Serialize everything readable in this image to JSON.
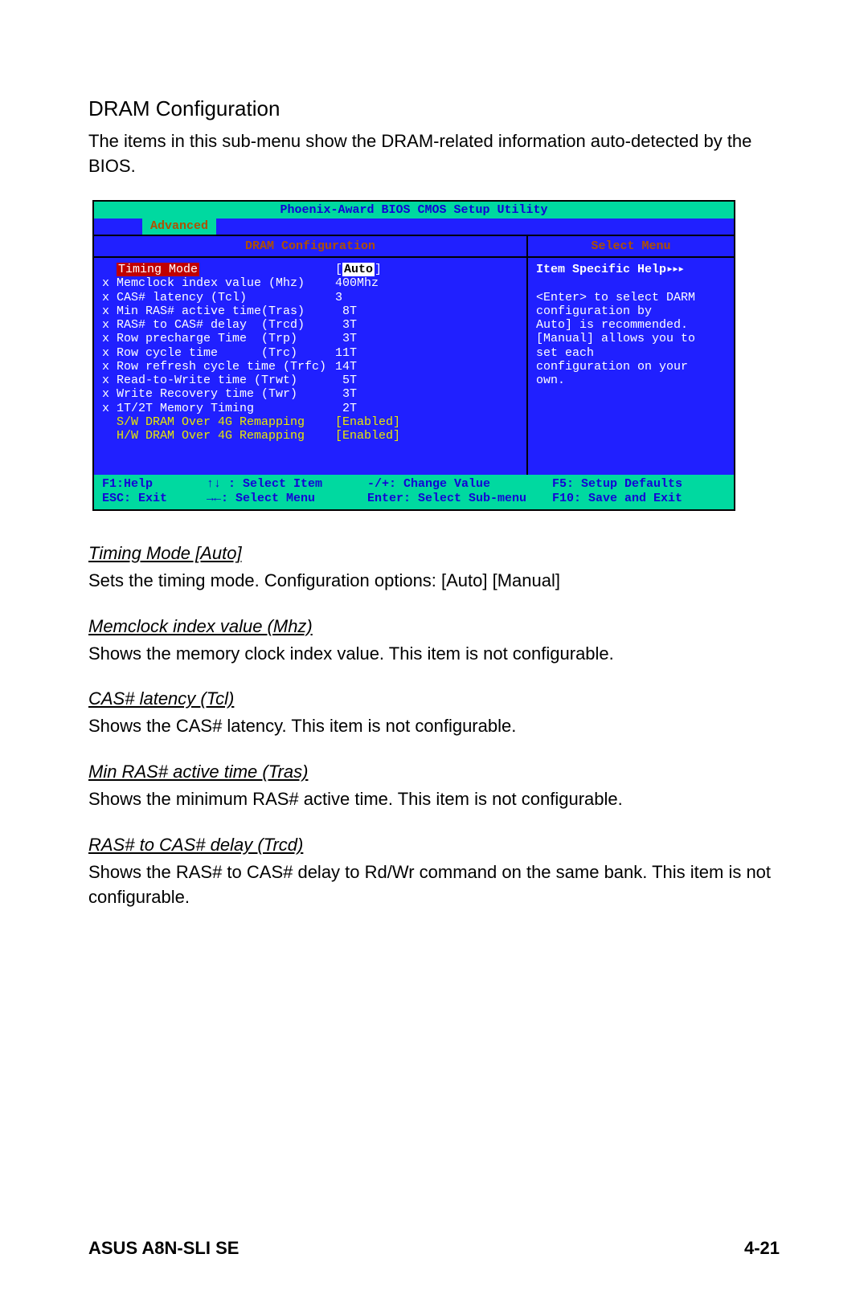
{
  "heading": "DRAM Configuration",
  "intro": "The items in this sub-menu show the DRAM-related information auto-detected by the BIOS.",
  "bios": {
    "title": "Phoenix-Award BIOS CMOS Setup Utility",
    "menuTab": "Advanced",
    "leftHeader": "DRAM Configuration",
    "rightHeader": "Select Menu",
    "rows": [
      {
        "label": "  Timing Mode",
        "value": "Auto",
        "selected": true
      },
      {
        "label": "x Memclock index value (Mhz)",
        "value": "400Mhz"
      },
      {
        "label": "x CAS# latency (Tcl)",
        "value": "3"
      },
      {
        "label": "x Min RAS# active time(Tras)",
        "value": " 8T"
      },
      {
        "label": "x RAS# to CAS# delay  (Trcd)",
        "value": " 3T"
      },
      {
        "label": "x Row precharge Time  (Trp)",
        "value": " 3T"
      },
      {
        "label": "x Row cycle time      (Trc)",
        "value": "11T"
      },
      {
        "label": "x Row refresh cycle time (Trfc)",
        "value": "14T"
      },
      {
        "label": "x Read-to-Write time (Trwt)",
        "value": " 5T"
      },
      {
        "label": "x Write Recovery time (Twr)",
        "value": " 3T"
      },
      {
        "label": "x 1T/2T Memory Timing",
        "value": " 2T"
      },
      {
        "label": "  S/W DRAM Over 4G Remapping",
        "value": "[Enabled]",
        "yellow": true
      },
      {
        "label": "  H/W DRAM Over 4G Remapping",
        "value": "[Enabled]",
        "yellow": true
      }
    ],
    "help": {
      "title": "Item Specific Help",
      "arrows": "▸▸▸",
      "lines": [
        "",
        "<Enter> to select DARM",
        "configuration by",
        "Auto] is recommended.",
        "[Manual] allows you to",
        "set each",
        "configuration on your",
        "own."
      ]
    },
    "footer": {
      "c1a": "F1:Help",
      "c2a": "↑↓ : Select Item",
      "c3a": "-/+: Change Value",
      "c4a": "F5: Setup Defaults",
      "c1b": "ESC: Exit",
      "c2b": "→←: Select Menu",
      "c3b": "Enter: Select Sub-menu",
      "c4b": "F10: Save and Exit"
    }
  },
  "defs": [
    {
      "title": "Timing Mode [Auto]",
      "body": "Sets the timing mode. Configuration options: [Auto] [Manual]"
    },
    {
      "title": "Memclock index value (Mhz)",
      "body": "Shows the memory clock index value. This item is not configurable."
    },
    {
      "title": "CAS# latency (Tcl)",
      "body": "Shows the CAS# latency. This item is not configurable."
    },
    {
      "title": "Min RAS# active time (Tras)",
      "body": "Shows the minimum RAS# active time. This item is not configurable."
    },
    {
      "title": "RAS# to CAS# delay (Trcd)",
      "body": "Shows the RAS# to CAS# delay to Rd/Wr command on the same bank. This item is not configurable."
    }
  ],
  "footer": {
    "left": "ASUS A8N-SLI SE",
    "right": "4-21"
  }
}
